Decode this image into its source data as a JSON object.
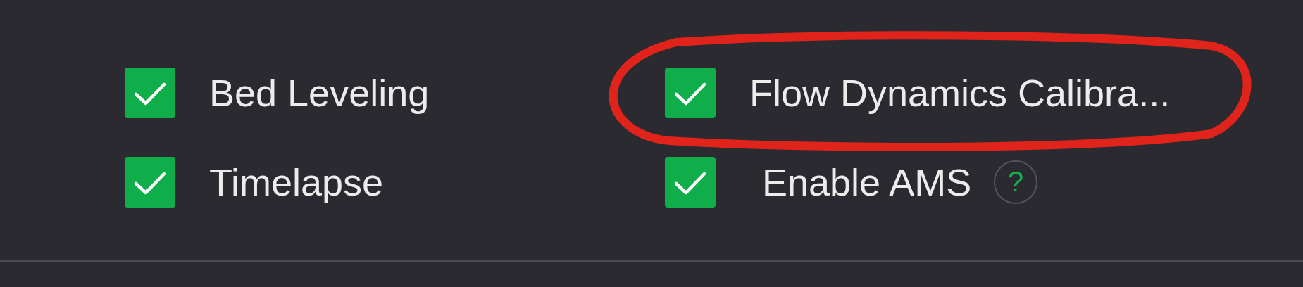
{
  "options": [
    {
      "label": "Bed Leveling",
      "checked": true,
      "highlighted": false
    },
    {
      "label": "Flow Dynamics Calibra...",
      "checked": true,
      "highlighted": true
    },
    {
      "label": "Timelapse",
      "checked": true,
      "highlighted": false
    },
    {
      "label": "Enable AMS",
      "checked": true,
      "help": "?",
      "highlighted": false
    }
  ]
}
